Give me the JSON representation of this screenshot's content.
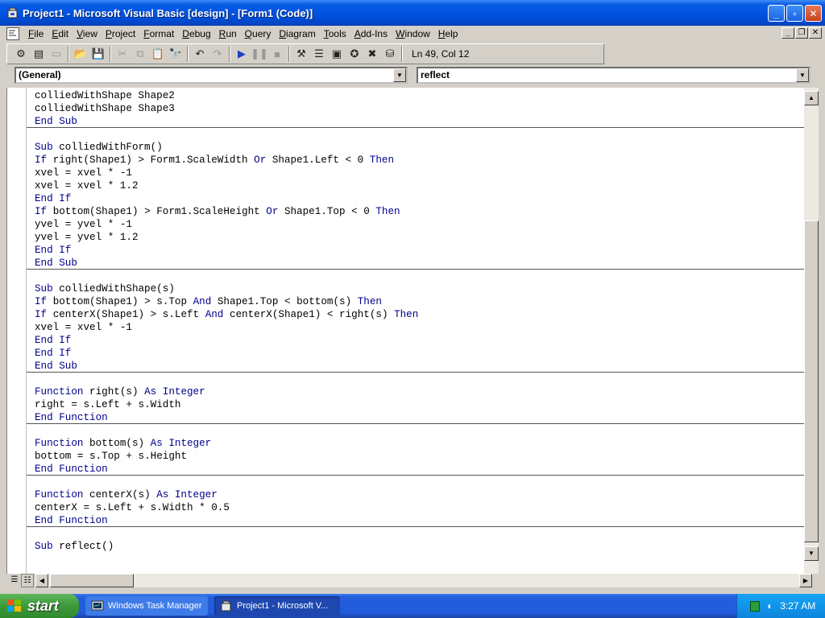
{
  "window": {
    "title": "Project1 - Microsoft Visual Basic [design] - [Form1 (Code)]"
  },
  "menu": [
    "File",
    "Edit",
    "View",
    "Project",
    "Format",
    "Debug",
    "Run",
    "Query",
    "Diagram",
    "Tools",
    "Add-Ins",
    "Window",
    "Help"
  ],
  "toolbar": {
    "position_text": "Ln 49, Col 12"
  },
  "combos": {
    "object": "(General)",
    "procedure": "reflect"
  },
  "code": {
    "lines": [
      "colliedWithShape Shape2",
      "colliedWithShape Shape3",
      "End Sub",
      "",
      "Sub colliedWithForm()",
      "If right(Shape1) > Form1.ScaleWidth Or Shape1.Left < 0 Then",
      "xvel = xvel * -1",
      "xvel = xvel * 1.2",
      "End If",
      "If bottom(Shape1) > Form1.ScaleHeight Or Shape1.Top < 0 Then",
      "yvel = yvel * -1",
      "yvel = yvel * 1.2",
      "End If",
      "End Sub",
      "",
      "Sub colliedWithShape(s)",
      "If bottom(Shape1) > s.Top And Shape1.Top < bottom(s) Then",
      "If centerX(Shape1) > s.Left And centerX(Shape1) < right(s) Then",
      "xvel = xvel * -1",
      "End If",
      "End If",
      "End Sub",
      "",
      "Function right(s) As Integer",
      "right = s.Left + s.Width",
      "End Function",
      "",
      "Function bottom(s) As Integer",
      "bottom = s.Top + s.Height",
      "End Function",
      "",
      "Function centerX(s) As Integer",
      "centerX = s.Left + s.Width * 0.5",
      "End Function",
      "",
      "Sub reflect()"
    ]
  },
  "taskbar": {
    "start_label": "start",
    "tasks": [
      "Windows Task Manager",
      "Project1 - Microsoft V..."
    ],
    "clock": "3:27 AM"
  }
}
